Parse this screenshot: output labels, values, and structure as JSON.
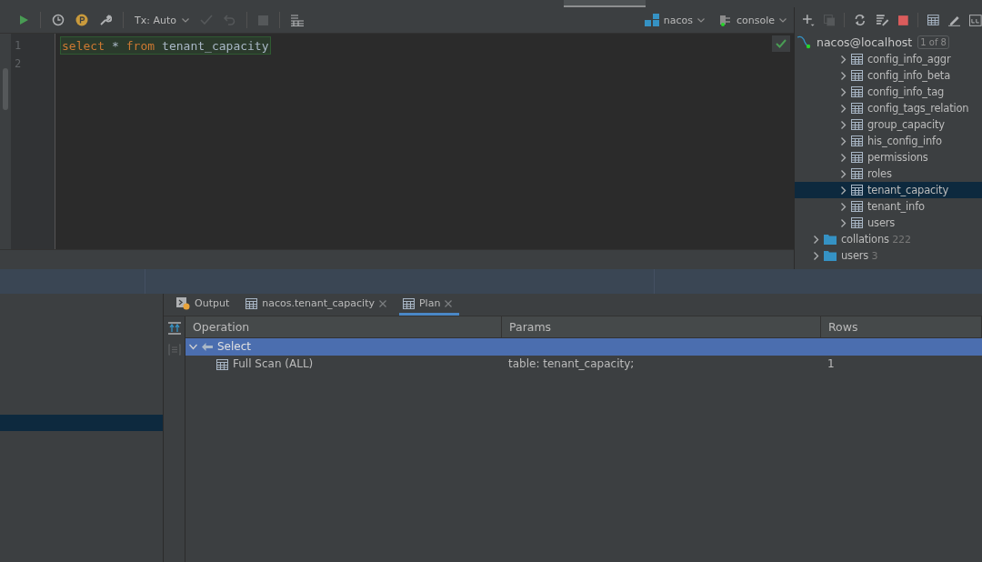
{
  "toolbar": {
    "tx_mode": "Tx: Auto",
    "datasource": "nacos",
    "session": "console"
  },
  "editor": {
    "lines": [
      {
        "number": "1",
        "tokens": [
          {
            "kind": "keyword",
            "text": "select"
          },
          {
            "kind": "operator",
            "text": "*"
          },
          {
            "kind": "keyword",
            "text": "from"
          },
          {
            "kind": "identifier",
            "text": "tenant_capacity"
          }
        ]
      },
      {
        "number": "2"
      }
    ]
  },
  "database": {
    "root": {
      "label": "nacos@localhost",
      "badge": "1 of 8"
    },
    "items": [
      {
        "kind": "table",
        "label": "config_info_aggr",
        "expanded": false,
        "selected": false
      },
      {
        "kind": "table",
        "label": "config_info_beta",
        "expanded": false,
        "selected": false
      },
      {
        "kind": "table",
        "label": "config_info_tag",
        "expanded": false,
        "selected": false
      },
      {
        "kind": "table",
        "label": "config_tags_relation",
        "expanded": false,
        "selected": false
      },
      {
        "kind": "table",
        "label": "group_capacity",
        "expanded": false,
        "selected": false
      },
      {
        "kind": "table",
        "label": "his_config_info",
        "expanded": false,
        "selected": false
      },
      {
        "kind": "table",
        "label": "permissions",
        "expanded": false,
        "selected": false
      },
      {
        "kind": "table",
        "label": "roles",
        "expanded": false,
        "selected": false
      },
      {
        "kind": "table",
        "label": "tenant_capacity",
        "expanded": false,
        "selected": true
      },
      {
        "kind": "table",
        "label": "tenant_info",
        "expanded": false,
        "selected": false
      },
      {
        "kind": "table",
        "label": "users",
        "expanded": false,
        "selected": false
      },
      {
        "kind": "folder",
        "label": "collations",
        "count": "222",
        "expanded": false,
        "selected": false
      },
      {
        "kind": "folder",
        "label": "users",
        "count": "3",
        "expanded": false,
        "selected": false
      }
    ]
  },
  "results": {
    "tabs": [
      {
        "kind": "console",
        "label": "Output",
        "closable": false,
        "selected": false
      },
      {
        "kind": "table",
        "label": "nacos.tenant_capacity",
        "closable": true,
        "selected": false
      },
      {
        "kind": "table",
        "label": "Plan",
        "closable": true,
        "selected": true
      }
    ],
    "columns": [
      "Operation",
      "Params",
      "Rows"
    ],
    "rows": [
      {
        "kind": "select",
        "operation": "Select",
        "expanded": true,
        "selected": true,
        "children": [
          {
            "kind": "table",
            "operation": "Full Scan (ALL)",
            "params": "table: tenant_capacity;",
            "rows": "1",
            "selected": false
          }
        ]
      }
    ]
  }
}
